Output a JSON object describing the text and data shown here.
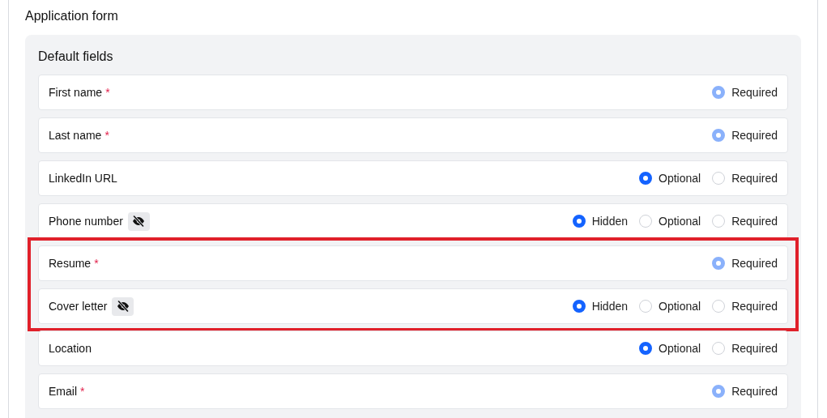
{
  "title": "Application form",
  "section": {
    "title": "Default fields",
    "fields": [
      {
        "label": "First name",
        "required_mark": "*",
        "hidden_icon": false,
        "highlighted": false,
        "options": [
          {
            "label": "Required",
            "selected": true,
            "disabled": true
          }
        ]
      },
      {
        "label": "Last name",
        "required_mark": "*",
        "hidden_icon": false,
        "highlighted": false,
        "options": [
          {
            "label": "Required",
            "selected": true,
            "disabled": true
          }
        ]
      },
      {
        "label": "LinkedIn URL",
        "hidden_icon": false,
        "highlighted": false,
        "options": [
          {
            "label": "Optional",
            "selected": true,
            "disabled": false
          },
          {
            "label": "Required",
            "selected": false,
            "disabled": false
          }
        ]
      },
      {
        "label": "Phone number",
        "hidden_icon": true,
        "highlighted": false,
        "options": [
          {
            "label": "Hidden",
            "selected": true,
            "disabled": false
          },
          {
            "label": "Optional",
            "selected": false,
            "disabled": false
          },
          {
            "label": "Required",
            "selected": false,
            "disabled": false
          }
        ]
      },
      {
        "label": "Resume",
        "required_mark": "*",
        "hidden_icon": false,
        "highlighted": true,
        "options": [
          {
            "label": "Required",
            "selected": true,
            "disabled": true
          }
        ]
      },
      {
        "label": "Cover letter",
        "hidden_icon": true,
        "highlighted": true,
        "options": [
          {
            "label": "Hidden",
            "selected": true,
            "disabled": false
          },
          {
            "label": "Optional",
            "selected": false,
            "disabled": false
          },
          {
            "label": "Required",
            "selected": false,
            "disabled": false
          }
        ]
      },
      {
        "label": "Location",
        "hidden_icon": false,
        "highlighted": false,
        "options": [
          {
            "label": "Optional",
            "selected": true,
            "disabled": false
          },
          {
            "label": "Required",
            "selected": false,
            "disabled": false
          }
        ]
      },
      {
        "label": "Email",
        "required_mark": "*",
        "hidden_icon": false,
        "highlighted": false,
        "options": [
          {
            "label": "Required",
            "selected": true,
            "disabled": true
          }
        ]
      }
    ]
  }
}
